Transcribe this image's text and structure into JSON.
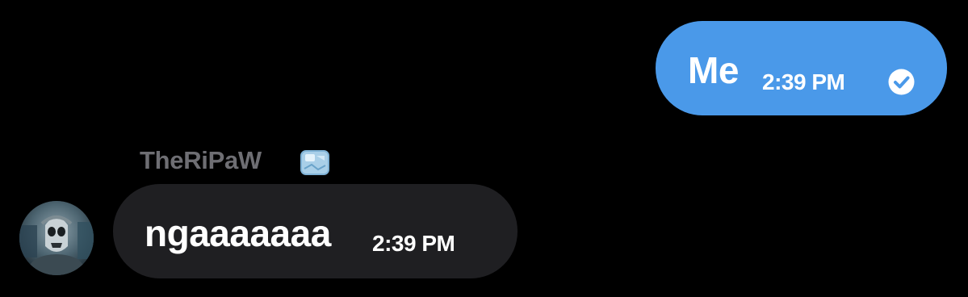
{
  "outgoing_message": {
    "text": "Me",
    "time": "2:39 PM",
    "status_icon": "read-check-icon",
    "bubble_color": "#4A99E9"
  },
  "incoming_message": {
    "sender_name": "TheRiPaW",
    "sender_badge_icon": "ice-cube-icon",
    "avatar_icon": "avatar",
    "text": "ngaaaaaaa",
    "time": "2:39 PM",
    "bubble_color": "#1F1F22"
  },
  "colors": {
    "background": "#000000",
    "sender_name": "#6E6E73",
    "text": "#FFFFFF"
  }
}
